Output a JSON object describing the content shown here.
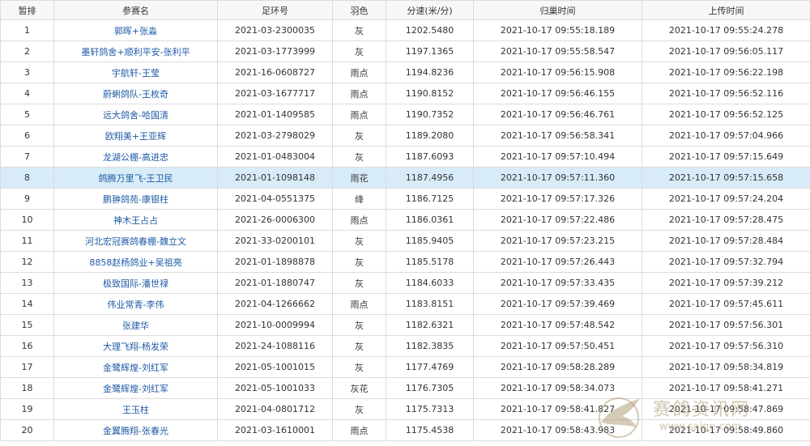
{
  "columns": [
    "暂排",
    "参赛名",
    "足环号",
    "羽色",
    "分速(米/分)",
    "归巢时间",
    "上传时间"
  ],
  "rows": [
    [
      "1",
      "郭晖+张淼",
      "2021-03-2300035",
      "灰",
      "1202.5480",
      "2021-10-17 09:55:18.189",
      "2021-10-17 09:55:24.278"
    ],
    [
      "2",
      "墨轩鸽舍+顺利平安-张利平",
      "2021-03-1773999",
      "灰",
      "1197.1365",
      "2021-10-17 09:55:58.547",
      "2021-10-17 09:56:05.117"
    ],
    [
      "3",
      "宇航轩-王莹",
      "2021-16-0608727",
      "雨点",
      "1194.8236",
      "2021-10-17 09:56:15.908",
      "2021-10-17 09:56:22.198"
    ],
    [
      "4",
      "蔚蜊鸽队-王枚奇",
      "2021-03-1677717",
      "雨点",
      "1190.8152",
      "2021-10-17 09:56:46.155",
      "2021-10-17 09:56:52.116"
    ],
    [
      "5",
      "远大鸽舍-哈国清",
      "2021-01-1409585",
      "雨点",
      "1190.7352",
      "2021-10-17 09:56:46.761",
      "2021-10-17 09:56:52.125"
    ],
    [
      "6",
      "欧翔美+王亚辉",
      "2021-03-2798029",
      "灰",
      "1189.2080",
      "2021-10-17 09:56:58.341",
      "2021-10-17 09:57:04.966"
    ],
    [
      "7",
      "龙湖公棚-高进忠",
      "2021-01-0483004",
      "灰",
      "1187.6093",
      "2021-10-17 09:57:10.494",
      "2021-10-17 09:57:15.649"
    ],
    [
      "8",
      "鸽腾万里飞-王卫民",
      "2021-01-1098148",
      "雨花",
      "1187.4956",
      "2021-10-17 09:57:11.360",
      "2021-10-17 09:57:15.658"
    ],
    [
      "9",
      "鹏翀鸽苑-康银柱",
      "2021-04-0551375",
      "绛",
      "1186.7125",
      "2021-10-17 09:57:17.326",
      "2021-10-17 09:57:24.204"
    ],
    [
      "10",
      "神木王占占",
      "2021-26-0006300",
      "雨点",
      "1186.0361",
      "2021-10-17 09:57:22.486",
      "2021-10-17 09:57:28.475"
    ],
    [
      "11",
      "河北宏冠赛鸽春棚-魏立文",
      "2021-33-0200101",
      "灰",
      "1185.9405",
      "2021-10-17 09:57:23.215",
      "2021-10-17 09:57:28.484"
    ],
    [
      "12",
      "8858赵杨鸽业+吴祖亮",
      "2021-01-1898878",
      "灰",
      "1185.5178",
      "2021-10-17 09:57:26.443",
      "2021-10-17 09:57:32.794"
    ],
    [
      "13",
      "极致国际-潘世禄",
      "2021-01-1880747",
      "灰",
      "1184.6033",
      "2021-10-17 09:57:33.435",
      "2021-10-17 09:57:39.212"
    ],
    [
      "14",
      "伟业常青-李伟",
      "2021-04-1266662",
      "雨点",
      "1183.8151",
      "2021-10-17 09:57:39.469",
      "2021-10-17 09:57:45.611"
    ],
    [
      "15",
      "张建华",
      "2021-10-0009994",
      "灰",
      "1182.6321",
      "2021-10-17 09:57:48.542",
      "2021-10-17 09:57:56.301"
    ],
    [
      "16",
      "大理飞翔-杨发荣",
      "2021-24-1088116",
      "灰",
      "1182.3835",
      "2021-10-17 09:57:50.451",
      "2021-10-17 09:57:56.310"
    ],
    [
      "17",
      "金鹭辉煌-刘红军",
      "2021-05-1001015",
      "灰",
      "1177.4769",
      "2021-10-17 09:58:28.289",
      "2021-10-17 09:58:34.819"
    ],
    [
      "18",
      "金鹭辉煌-刘红军",
      "2021-05-1001033",
      "灰花",
      "1176.7305",
      "2021-10-17 09:58:34.073",
      "2021-10-17 09:58:41.271"
    ],
    [
      "19",
      "王玉柱",
      "2021-04-0801712",
      "灰",
      "1175.7313",
      "2021-10-17 09:58:41.827",
      "2021-10-17 09:58:47.869"
    ],
    [
      "20",
      "金翼腾翔-张春光",
      "2021-03-1610001",
      "雨点",
      "1175.4538",
      "2021-10-17 09:58:43.983",
      "2021-10-17 09:58:49.860"
    ]
  ],
  "highlighted_row": 8,
  "watermark": {
    "text": "赛鸽资讯网",
    "url": "www.saige.com",
    "icon": "pigeon-logo-icon"
  },
  "colors": {
    "name_link": "#1f5aa6",
    "highlight": "#d8ecf8",
    "border": "#dcdcdc"
  }
}
